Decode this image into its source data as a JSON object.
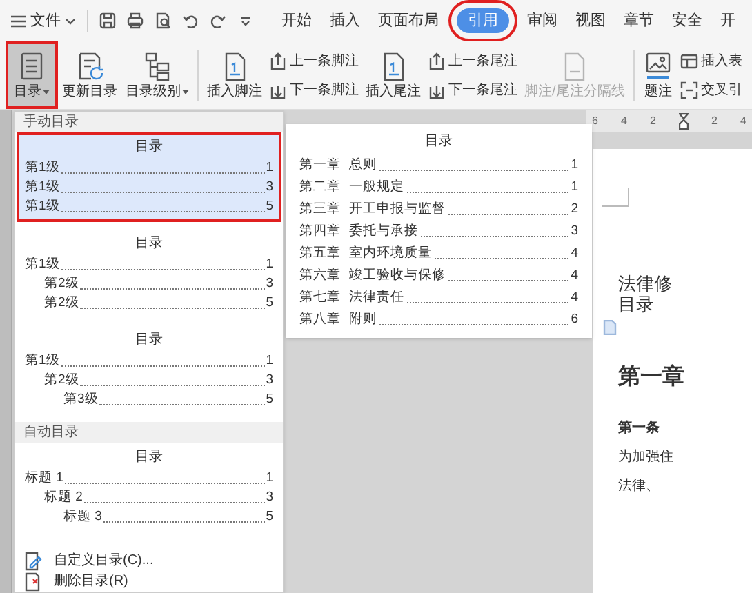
{
  "title_bar": {
    "menu_label": "文件",
    "tabs": [
      {
        "label": "开始",
        "selected": false
      },
      {
        "label": "插入",
        "selected": false
      },
      {
        "label": "页面布局",
        "selected": false
      },
      {
        "label": "引用",
        "selected": true
      },
      {
        "label": "审阅",
        "selected": false
      },
      {
        "label": "视图",
        "selected": false
      },
      {
        "label": "章节",
        "selected": false
      },
      {
        "label": "安全",
        "selected": false
      },
      {
        "label": "开",
        "selected": false
      }
    ]
  },
  "ribbon": {
    "groups": [
      {
        "items": [
          {
            "kind": "large",
            "label": "目录",
            "dropdown": true,
            "selected": true,
            "disabled": false
          },
          {
            "kind": "large",
            "label": "更新目录",
            "dropdown": false,
            "selected": false,
            "disabled": false
          },
          {
            "kind": "large",
            "label": "目录级别",
            "dropdown": true,
            "selected": false,
            "disabled": false
          }
        ]
      },
      {
        "items": [
          {
            "kind": "large",
            "label": "插入脚注",
            "dropdown": false,
            "selected": false,
            "disabled": false
          },
          {
            "kind": "stack",
            "buttons": [
              {
                "label": "上一条脚注",
                "disabled": false
              },
              {
                "label": "下一条脚注",
                "disabled": false
              }
            ]
          },
          {
            "kind": "large",
            "label": "插入尾注",
            "dropdown": false,
            "selected": false,
            "disabled": false
          },
          {
            "kind": "stack",
            "buttons": [
              {
                "label": "上一条尾注",
                "disabled": false
              },
              {
                "label": "下一条尾注",
                "disabled": false
              }
            ]
          },
          {
            "kind": "large",
            "label": "脚注/尾注分隔线",
            "dropdown": false,
            "selected": false,
            "disabled": true
          }
        ]
      },
      {
        "items": [
          {
            "kind": "large",
            "label": "题注",
            "dropdown": false,
            "selected": false,
            "disabled": false
          },
          {
            "kind": "stack",
            "buttons": [
              {
                "label": "插入表",
                "disabled": false
              },
              {
                "label": "交叉引",
                "disabled": false
              }
            ]
          }
        ]
      }
    ]
  },
  "toc_menu": {
    "sections": [
      {
        "header": "手动目录",
        "options": [
          {
            "selected": true,
            "title": "目录",
            "entries": [
              {
                "label": "第1级",
                "page": "1"
              },
              {
                "label": "第1级",
                "page": "3"
              },
              {
                "label": "第1级",
                "page": "5"
              }
            ]
          },
          {
            "selected": false,
            "title": "目录",
            "entries": [
              {
                "label": "第1级",
                "page": "1",
                "children": [
                  {
                    "label": "第2级",
                    "page": "3"
                  },
                  {
                    "label": "第2级",
                    "page": "5"
                  }
                ]
              }
            ]
          },
          {
            "selected": false,
            "title": "目录",
            "entries": [
              {
                "label": "第1级",
                "page": "1",
                "children": [
                  {
                    "label": "第2级",
                    "page": "3",
                    "children": [
                      {
                        "label": "第3级",
                        "page": "5"
                      }
                    ]
                  }
                ]
              }
            ]
          }
        ]
      },
      {
        "header": "自动目录",
        "options": [
          {
            "selected": false,
            "title": "目录",
            "entries": [
              {
                "label": "标题 1",
                "page": "1",
                "children": [
                  {
                    "label": "标题 2",
                    "page": "3",
                    "children": [
                      {
                        "label": "标题 3",
                        "page": "5"
                      }
                    ]
                  }
                ]
              }
            ]
          }
        ]
      }
    ],
    "commands": [
      {
        "label": "自定义目录(C)..."
      },
      {
        "label": "删除目录(R)"
      }
    ]
  },
  "toc_preview": {
    "title": "目录",
    "entries": [
      {
        "chapter": "第一章",
        "name": "总则",
        "page": "1"
      },
      {
        "chapter": "第二章",
        "name": "一般规定",
        "page": "1"
      },
      {
        "chapter": "第三章",
        "name": "开工申报与监督",
        "page": "2"
      },
      {
        "chapter": "第四章",
        "name": "委托与承接",
        "page": "3"
      },
      {
        "chapter": "第五章",
        "name": "室内环境质量",
        "page": "4"
      },
      {
        "chapter": "第六章",
        "name": "竣工验收与保修",
        "page": "4"
      },
      {
        "chapter": "第七章",
        "name": "法律责任",
        "page": "4"
      },
      {
        "chapter": "第八章",
        "name": "附则",
        "page": "6"
      }
    ]
  },
  "document": {
    "ruler_labels": [
      "6",
      "4",
      "2",
      "2",
      "4"
    ],
    "heading": "法律修",
    "toc_label": "目录",
    "chapter": "第一章",
    "article": "第一条",
    "lines": [
      "为加强住",
      "法律、"
    ]
  }
}
